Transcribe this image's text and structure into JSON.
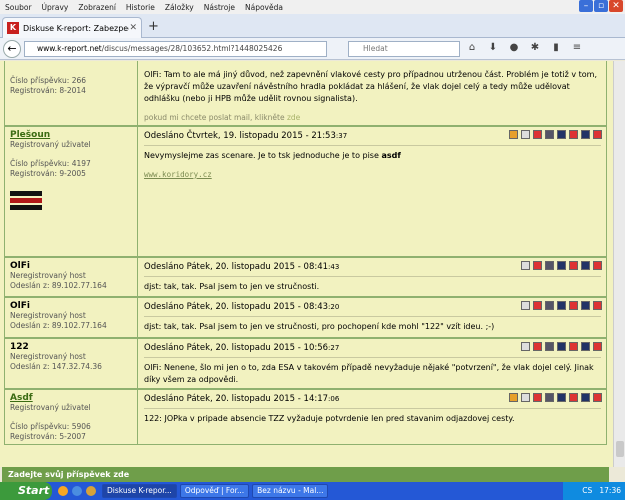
{
  "menu": [
    "Soubor",
    "Úpravy",
    "Zobrazení",
    "Historie",
    "Záložky",
    "Nástroje",
    "Nápověda"
  ],
  "tab": {
    "title": "Diskuse K-report: Zabezpeč...",
    "favicon": "K"
  },
  "url": {
    "domain": "www.k-report.net",
    "path": "/discus/messages/28/103652.html?1448025426"
  },
  "search": {
    "placeholder": "Hledat"
  },
  "posts": [
    {
      "user": "",
      "user_link": false,
      "stat1": "Číslo příspěvku: 266",
      "stat2": "Registrován: 8-2014",
      "header": "",
      "time_small": "",
      "body": "OlFi: Tam to ale má jiný důvod, než zapevnění vlakové cesty pro případnou utrženou část. Problém je totiž v tom, že výpravčí může uzavření návěstního hradla pokládat za hlášení, že vlak dojel celý a tedy může udělovat odhlášku (nebo ji HPB může udělit rovnou signalista).",
      "mailnote": "pokud mi chcete poslat mail, klikněte",
      "mailnote_link": "zde"
    },
    {
      "user": "Plešoun",
      "user_link": true,
      "stat1": "Registrovaný uživatel",
      "stat2": "Číslo příspěvku: 4197",
      "stat3": "Registrován: 9-2005",
      "header": "Odesláno Čtvrtek, 19. listopadu 2015 - 21:53",
      "time_small": ":37",
      "body_pre": "Nevymyslejme zas scenare. Je to tsk jednoduche je to pise ",
      "body_bold": "asdf",
      "sig": "www.koridory.cz"
    },
    {
      "user": "OlFi",
      "user_link": false,
      "stat1": "Neregistrovaný host",
      "stat2": "Odeslán z:  89.102.77.164",
      "header": "Odesláno Pátek, 20. listopadu 2015 - 08:41",
      "time_small": ":43",
      "body": "djst: tak, tak. Psal jsem to jen ve stručnosti."
    },
    {
      "user": "OlFi",
      "user_link": false,
      "stat1": "Neregistrovaný host",
      "stat2": "Odeslán z:  89.102.77.164",
      "header": "Odesláno Pátek, 20. listopadu 2015 - 08:43",
      "time_small": ":20",
      "body": "djst: tak, tak. Psal jsem to jen ve stručnosti, pro pochopení kde mohl \"122\" vzít ideu. ;-)"
    },
    {
      "user": "122",
      "user_link": false,
      "stat1": "Neregistrovaný host",
      "stat2": "Odeslán z:  147.32.74.36",
      "header": "Odesláno Pátek, 20. listopadu 2015 - 10:56",
      "time_small": ":27",
      "body": "OlFi: Nenene, šlo mi jen o to, zda ESA v takovém případě nevyžaduje nějaké \"potvrzení\", že vlak dojel celý. Jinak díky všem za odpovědi."
    },
    {
      "user": "Asdf",
      "user_link": true,
      "stat1": "Registrovaný uživatel",
      "stat2": "Číslo příspěvku: 5906",
      "stat3": "Registrován: 5-2007",
      "header": "Odesláno Pátek, 20. listopadu 2015 - 14:17",
      "time_small": ":06",
      "body": "122: JOPka v pripade absencie TZZ vyžaduje potvrdenie len pred stavanim odjazdovej cesty."
    }
  ],
  "reply_bar": "Zadejte svůj příspěvek zde",
  "taskbar": {
    "start": "Start",
    "tasks": [
      "Diskuse K-repor...",
      "Odpověď | For...",
      "Bez názvu - Mal..."
    ],
    "lang": "CS",
    "clock": "17:36"
  }
}
